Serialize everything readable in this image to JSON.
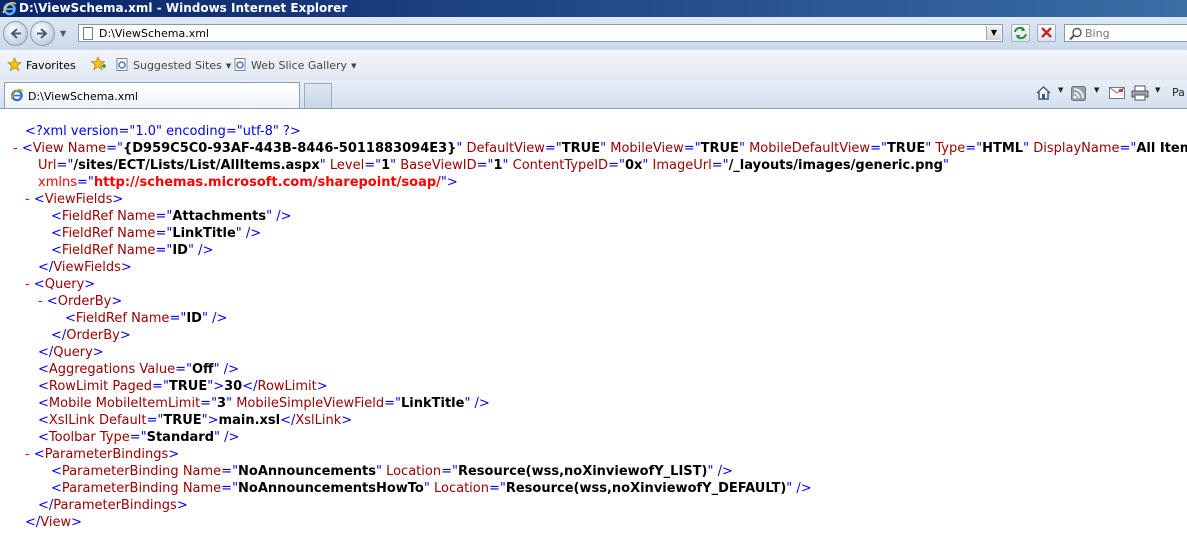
{
  "window": {
    "title": "D:\\ViewSchema.xml - Windows Internet Explorer"
  },
  "address": {
    "value": "D:\\ViewSchema.xml"
  },
  "search": {
    "placeholder": "Bing"
  },
  "favorites_bar": {
    "favorites_label": "Favorites",
    "items": [
      "Suggested Sites",
      "Web Slice Gallery"
    ]
  },
  "tabs": [
    {
      "label": "D:\\ViewSchema.xml"
    }
  ],
  "command_bar": {
    "page_label": "Pa"
  },
  "xml": {
    "decl": "<?xml version=\"1.0\" encoding=\"utf-8\" ?>",
    "view": {
      "name": "{D959C5C0-93AF-443B-8446-5011883094E3}",
      "default_view": "TRUE",
      "mobile_view": "TRUE",
      "mobile_default_view": "TRUE",
      "type": "HTML",
      "display_name": "All Items",
      "url": "/sites/ECT/Lists/List/AllItems.aspx",
      "level": "1",
      "base_view_id": "1",
      "content_type_id": "0x",
      "image_url": "/_layouts/images/generic.png",
      "xmlns": "http://schemas.microsoft.com/sharepoint/soap/"
    },
    "view_fields": [
      "Attachments",
      "LinkTitle",
      "ID"
    ],
    "orderby_field": "ID",
    "aggregations_value": "Off",
    "rowlimit_paged": "TRUE",
    "rowlimit_value": "30",
    "mobile_item_limit": "3",
    "mobile_simple_view_field": "LinkTitle",
    "xsllink_default": "TRUE",
    "xsllink_value": "main.xsl",
    "toolbar_type": "Standard",
    "parameter_bindings": [
      {
        "name": "NoAnnouncements",
        "location": "Resource(wss,noXinviewofY_LIST)"
      },
      {
        "name": "NoAnnouncementsHowTo",
        "location": "Resource(wss,noXinviewofY_DEFAULT)"
      }
    ]
  }
}
